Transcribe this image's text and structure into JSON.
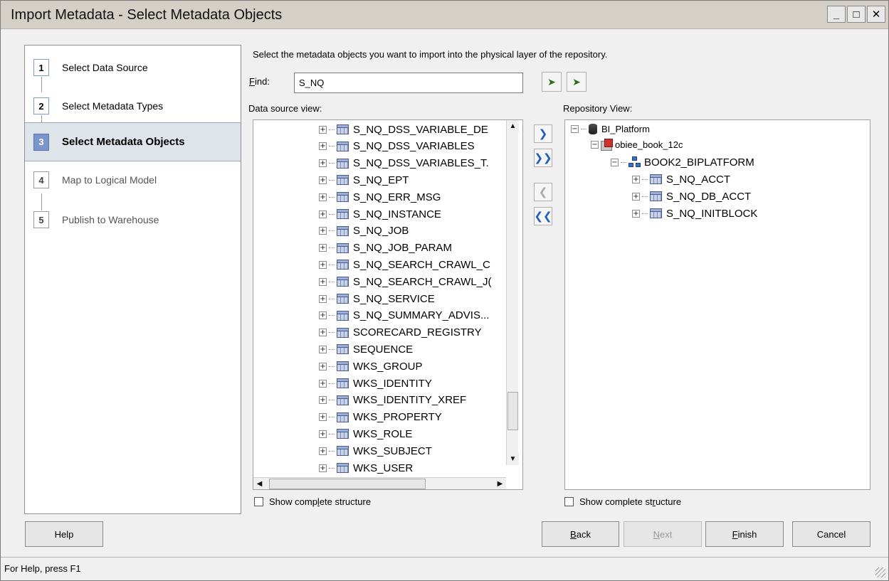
{
  "window": {
    "title": "Import Metadata - Select Metadata Objects",
    "minimize_glyph": "_",
    "maximize_glyph": "□",
    "close_glyph": "✕"
  },
  "steps": [
    {
      "num": "1",
      "label": "Select Data Source",
      "state": "done"
    },
    {
      "num": "2",
      "label": "Select Metadata Types",
      "state": "done"
    },
    {
      "num": "3",
      "label": "Select Metadata Objects",
      "state": "active"
    },
    {
      "num": "4",
      "label": "Map to Logical Model",
      "state": "future"
    },
    {
      "num": "5",
      "label": "Publish to Warehouse",
      "state": "future"
    }
  ],
  "main": {
    "instruction": "Select the metadata objects you want to import into the physical layer of the repository.",
    "find_label": "Find:",
    "find_value": "S_NQ",
    "data_source_label": "Data source view:",
    "repository_label": "Repository View:"
  },
  "data_source_tree": [
    "S_NQ_DSS_VARIABLE_DE",
    "S_NQ_DSS_VARIABLES",
    "S_NQ_DSS_VARIABLES_T.",
    "S_NQ_EPT",
    "S_NQ_ERR_MSG",
    "S_NQ_INSTANCE",
    "S_NQ_JOB",
    "S_NQ_JOB_PARAM",
    "S_NQ_SEARCH_CRAWL_C",
    "S_NQ_SEARCH_CRAWL_J(",
    "S_NQ_SERVICE",
    "S_NQ_SUMMARY_ADVIS...",
    "SCORECARD_REGISTRY",
    "SEQUENCE",
    "WKS_GROUP",
    "WKS_IDENTITY",
    "WKS_IDENTITY_XREF",
    "WKS_PROPERTY",
    "WKS_ROLE",
    "WKS_SUBJECT",
    "WKS_USER"
  ],
  "repository_tree": {
    "root": "BI_Platform",
    "database": "obiee_book_12c",
    "schema": "BOOK2_BIPLATFORM",
    "tables": [
      "S_NQ_ACCT",
      "S_NQ_DB_ACCT",
      "S_NQ_INITBLOCK"
    ]
  },
  "move_buttons": {
    "add": "❯",
    "add_all": "❯❯",
    "remove": "❮",
    "remove_all": "❮❮"
  },
  "checkboxes": {
    "left": {
      "pre": "Show comp",
      "ul": "l",
      "post": "ete structure"
    },
    "right": {
      "pre": "Show complete st",
      "ul": "r",
      "post": "ucture"
    }
  },
  "buttons": {
    "help": "Help",
    "back": {
      "ul": "B",
      "rest": "ack"
    },
    "next": {
      "ul": "N",
      "rest": "ext"
    },
    "finish": {
      "ul": "F",
      "rest": "inish"
    },
    "cancel": "Cancel"
  },
  "status": "For Help, press F1",
  "colors": {
    "active_step": "#7b94c9",
    "move_arrows": "#1f5fbf"
  }
}
